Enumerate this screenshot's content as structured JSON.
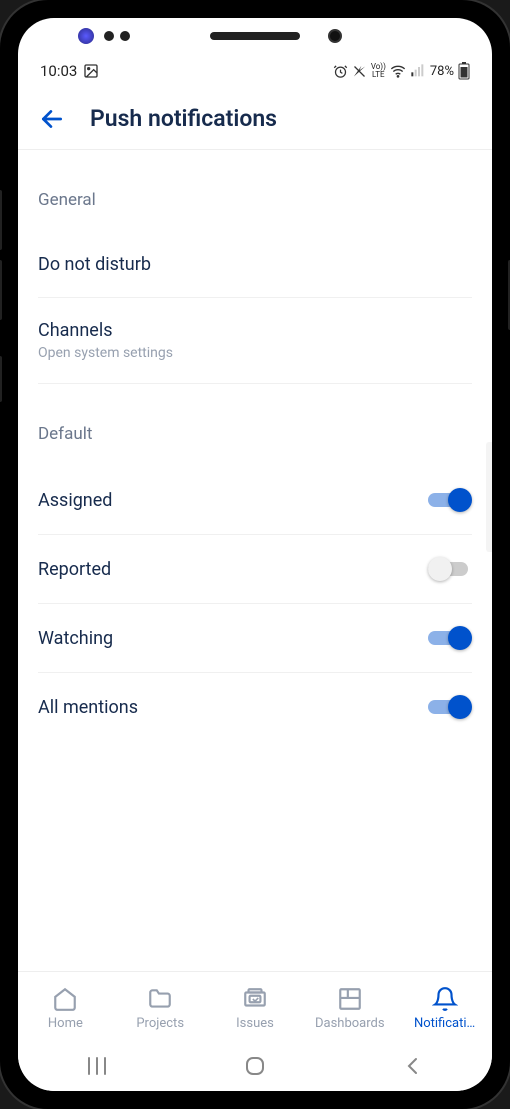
{
  "status": {
    "time": "10:03",
    "battery_pct": "78%"
  },
  "header": {
    "title": "Push notifications"
  },
  "sections": {
    "general": {
      "label": "General",
      "dnd": "Do not disturb",
      "channels": "Channels",
      "channels_sub": "Open system settings"
    },
    "default": {
      "label": "Default",
      "assigned": {
        "label": "Assigned",
        "on": true
      },
      "reported": {
        "label": "Reported",
        "on": false
      },
      "watching": {
        "label": "Watching",
        "on": true
      },
      "mentions": {
        "label": "All mentions",
        "on": true
      }
    }
  },
  "nav": {
    "home": "Home",
    "projects": "Projects",
    "issues": "Issues",
    "dashboards": "Dashboards",
    "notifications": "Notificati…"
  }
}
